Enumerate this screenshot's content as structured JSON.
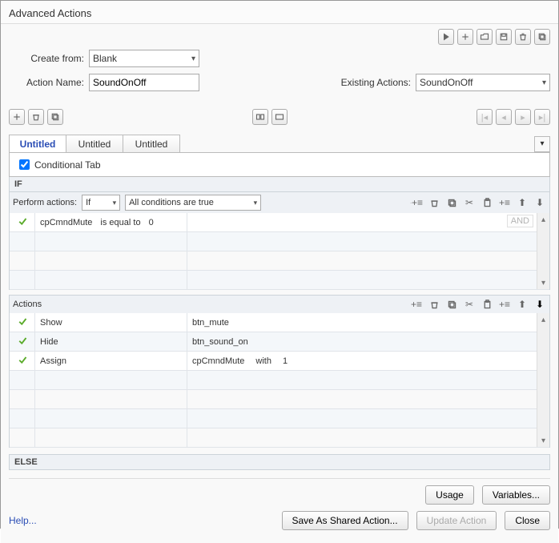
{
  "title": "Advanced Actions",
  "form": {
    "create_from_label": "Create from:",
    "create_from_value": "Blank",
    "action_name_label": "Action Name:",
    "action_name_value": "SoundOnOff",
    "existing_actions_label": "Existing Actions:",
    "existing_actions_value": "SoundOnOff"
  },
  "tabs": [
    "Untitled",
    "Untitled",
    "Untitled"
  ],
  "active_tab_index": 0,
  "conditional_tab_label": "Conditional Tab",
  "conditional_tab_checked": true,
  "if_label": "IF",
  "else_label": "ELSE",
  "perform_actions_label": "Perform actions:",
  "perform_if_value": "If",
  "perform_conditions_value": "All conditions are true",
  "conditions": [
    {
      "variable": "cpCmndMute",
      "operator": "is equal to",
      "value": "0"
    }
  ],
  "and_label": "AND",
  "actions_label": "Actions",
  "actions": [
    {
      "action": "Show",
      "target": "btn_mute",
      "with_label": "",
      "extra": ""
    },
    {
      "action": "Hide",
      "target": "btn_sound_on",
      "with_label": "",
      "extra": ""
    },
    {
      "action": "Assign",
      "target": "cpCmndMute",
      "with_label": "with",
      "extra": "1"
    }
  ],
  "footer": {
    "usage": "Usage",
    "variables": "Variables...",
    "save_shared": "Save As Shared Action...",
    "update": "Update Action",
    "close": "Close",
    "help": "Help..."
  }
}
